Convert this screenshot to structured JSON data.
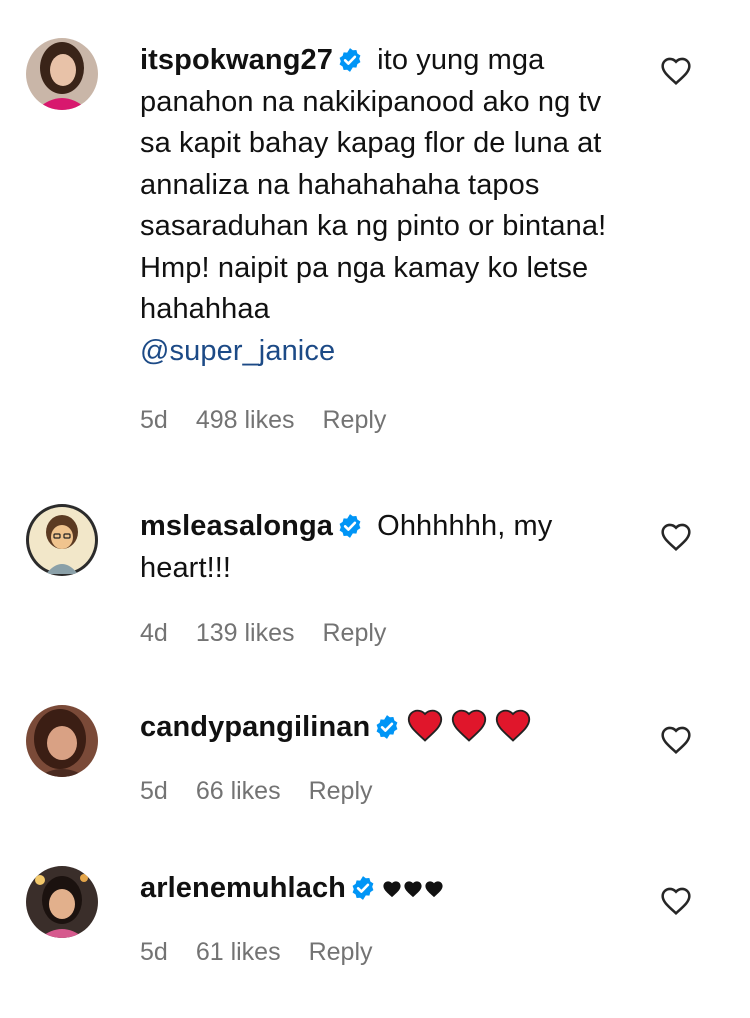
{
  "comments": [
    {
      "username": "itspokwang27",
      "text": " ito yung mga panahon na nakikipanood ako ng tv sa kapit bahay kapag flor de luna at annaliza na hahahahaha tapos sasaraduhan ka ng pinto or bintana! Hmp! naipit pa nga kamay ko letse hahahhaa",
      "mention": "@super_janice",
      "age": "5d",
      "likes": "498 likes",
      "reply": "Reply",
      "verified": true
    },
    {
      "username": "msleasalonga",
      "text": " Ohhhhhh, my heart!!!",
      "age": "4d",
      "likes": "139 likes",
      "reply": "Reply",
      "verified": true
    },
    {
      "username": "candypangilinan",
      "text": "",
      "emoji": "red-heart x3",
      "age": "5d",
      "likes": "66 likes",
      "reply": "Reply",
      "verified": true
    },
    {
      "username": "arlenemuhlach",
      "text": "",
      "emoji": "black-heart x3",
      "age": "5d",
      "likes": "61 likes",
      "reply": "Reply",
      "verified": true
    }
  ],
  "colors": {
    "verified_blue": "#0095f6",
    "mention": "#1c4a86",
    "meta_gray": "#737373",
    "heart_red": "#e0162b"
  }
}
